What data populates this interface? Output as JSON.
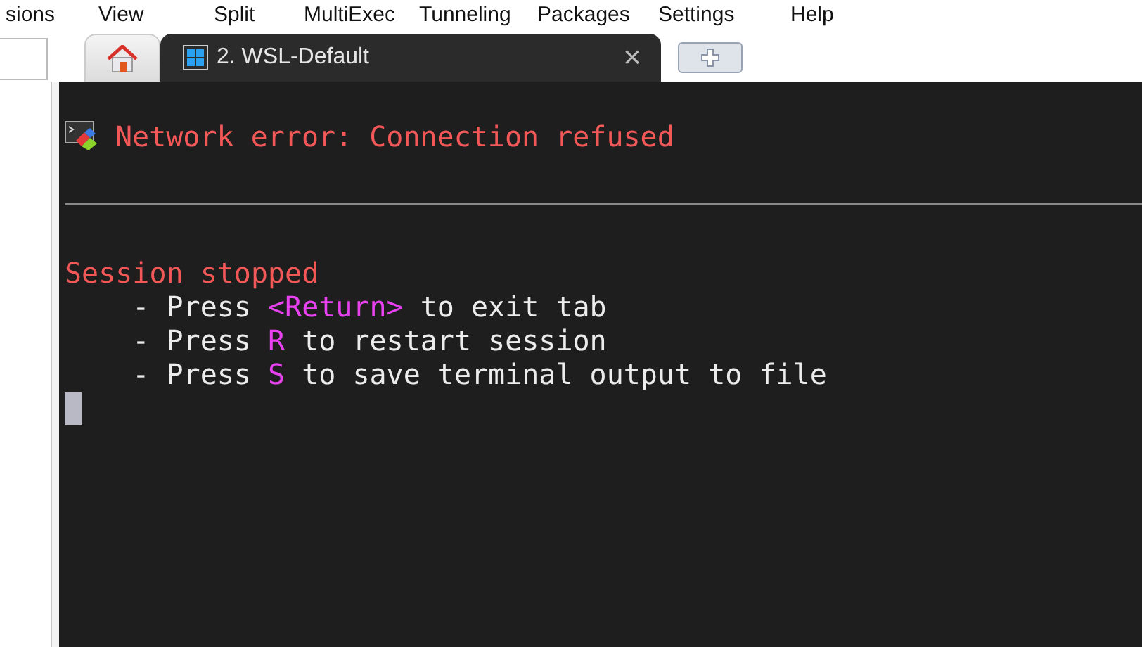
{
  "menu": [
    "sions",
    "View",
    "Split",
    "MultiExec",
    "Tunneling",
    "Packages",
    "Settings",
    "Help"
  ],
  "tabs": [
    {
      "kind": "home",
      "selected": false
    },
    {
      "kind": "session",
      "label": "2. WSL-Default",
      "close": "×",
      "selected": true
    },
    {
      "kind": "new",
      "selected": false
    }
  ],
  "terminal": {
    "error": "Network error: Connection refused",
    "lines": [
      [
        {
          "text": "Session stopped",
          "kind": "error"
        }
      ],
      [
        {
          "text": "    - Press ",
          "kind": "plain"
        },
        {
          "text": "<Return>",
          "kind": "key"
        },
        {
          "text": " to exit tab",
          "kind": "plain"
        }
      ],
      [
        {
          "text": "    - Press ",
          "kind": "plain"
        },
        {
          "text": "R",
          "kind": "key"
        },
        {
          "text": " to restart session",
          "kind": "plain"
        }
      ],
      [
        {
          "text": "    - Press ",
          "kind": "plain"
        },
        {
          "text": "S",
          "kind": "key"
        },
        {
          "text": " to save terminal output to file",
          "kind": "plain"
        }
      ]
    ]
  }
}
